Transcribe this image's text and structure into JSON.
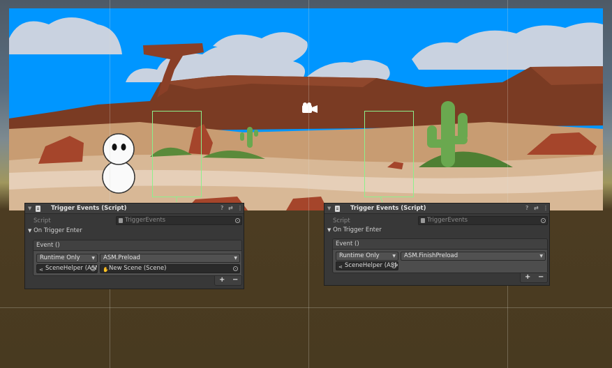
{
  "panels": [
    {
      "header_title": "Trigger Events (Script)",
      "script_label": "Script",
      "script_value": "TriggerEvents",
      "section_label": "On Trigger Enter",
      "event_label": "Event ()",
      "call_state": "Runtime Only",
      "function": "ASM.Preload",
      "target_object": "SceneHelper (ASM)",
      "argument": "New Scene (Scene)",
      "add_label": "+",
      "remove_label": "−"
    },
    {
      "header_title": "Trigger Events (Script)",
      "script_label": "Script",
      "script_value": "TriggerEvents",
      "section_label": "On Trigger Enter",
      "event_label": "Event ()",
      "call_state": "Runtime Only",
      "function": "ASM.FinishPreload",
      "target_object": "SceneHelper (ASM)",
      "add_label": "+",
      "remove_label": "−"
    }
  ],
  "header_icons": {
    "help": "?",
    "settings": "⇄",
    "menu": "⋮"
  },
  "colors": {
    "sky": "#0096ff",
    "trigger_outline": "#8cf08c",
    "editor_panel": "#383838"
  }
}
